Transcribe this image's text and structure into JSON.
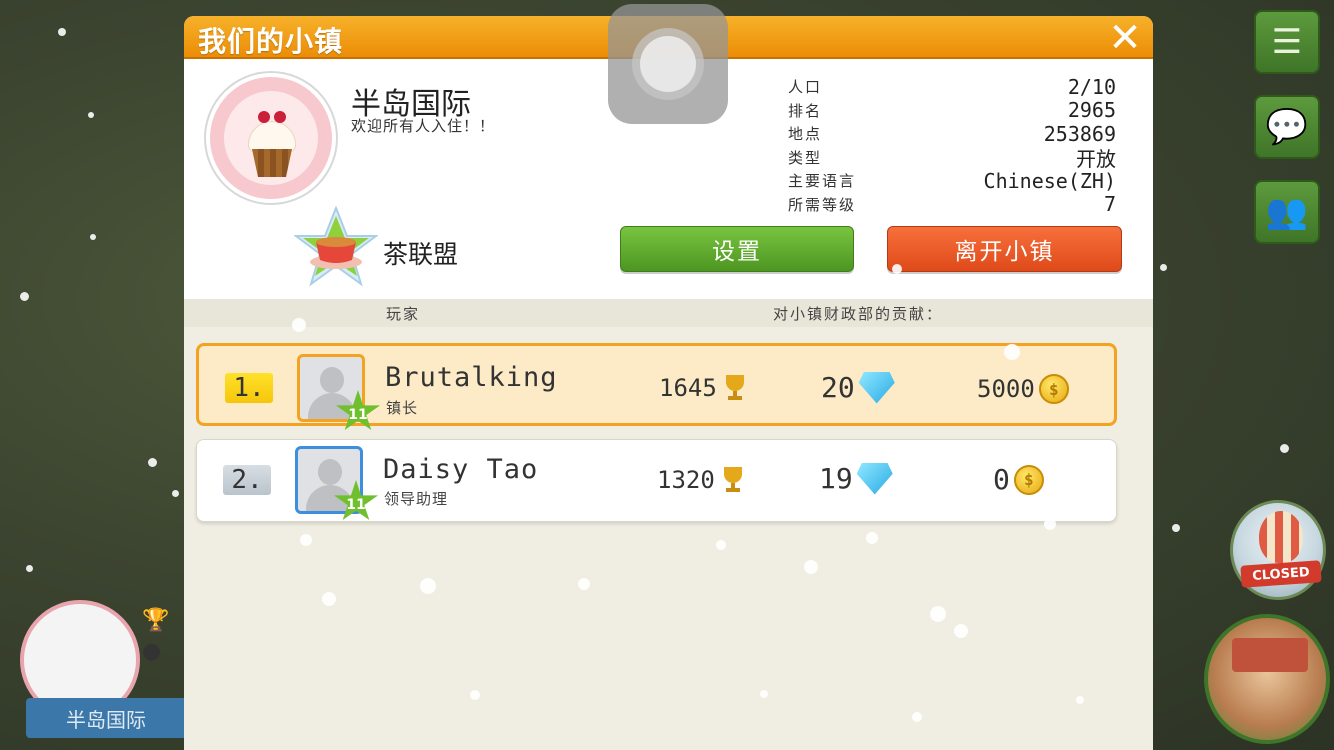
{
  "dialog": {
    "title": "我们的小镇",
    "close_icon": "✕"
  },
  "town": {
    "name": "半岛国际",
    "motto": "欢迎所有人入住！！",
    "alliance": "茶联盟",
    "stats": [
      {
        "label": "人口",
        "value": "2/10"
      },
      {
        "label": "排名",
        "value": "2965"
      },
      {
        "label": "地点",
        "value": "253869"
      },
      {
        "label": "类型",
        "value": "开放"
      },
      {
        "label": "主要语言",
        "value": "Chinese(ZH)"
      },
      {
        "label": "所需等级",
        "value": "7"
      }
    ]
  },
  "buttons": {
    "settings": "设置",
    "leave": "离开小镇"
  },
  "list_header": {
    "player": "玩家",
    "contribution": "对小镇财政部的贡献："
  },
  "members": [
    {
      "rank": "1.",
      "name": "Brutalking",
      "role": "镇长",
      "level": "11",
      "trophies": "1645",
      "gems": "20",
      "coins": "5000"
    },
    {
      "rank": "2.",
      "name": "Daisy Tao",
      "role": "领导助理",
      "level": "11",
      "trophies": "1320",
      "gems": "19",
      "coins": "0"
    }
  ],
  "background": {
    "town_label": "半岛国际",
    "closed_label": "CLOSED",
    "menu_icon": "☰",
    "chat_icon": "💬",
    "friends_icon": "👥"
  },
  "colors": {
    "header_orange": "#ec8d06",
    "settings_green": "#4d9622",
    "leave_red": "#df4a1a",
    "highlight_border": "#f3a221"
  }
}
